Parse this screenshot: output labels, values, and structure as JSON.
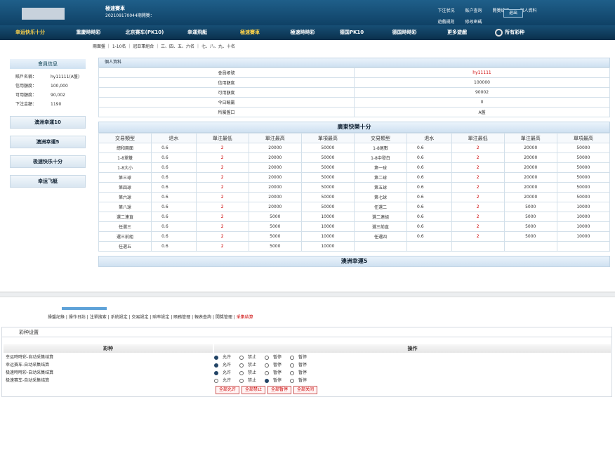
{
  "header": {
    "title": "極速賽車",
    "subtitle": "202109170044期開獎：",
    "links": [
      "下注状况",
      "账户查询",
      "開獎结果",
      "個人資料",
      "遊戲規則",
      "修改密碼"
    ],
    "logout": "退出"
  },
  "nav": [
    {
      "label": "幸运快乐十分",
      "active": true
    },
    {
      "label": "重慶時時彩"
    },
    {
      "label": "北京赛车(PK10)"
    },
    {
      "label": "幸運飛艇"
    },
    {
      "label": "極速賽車",
      "active": true
    },
    {
      "label": "極速時時彩"
    },
    {
      "label": "德国PK10"
    },
    {
      "label": "德国時時彩"
    },
    {
      "label": "更多遊戲"
    },
    {
      "label": "所有彩种"
    }
  ],
  "subnav": "兩面盤 ｜ 1-10名 ｜ 冠亞軍組合 ｜ 三、四、五、六名 ｜ 七、八、九、十名",
  "sidebar": {
    "header": "會員信息",
    "info": [
      {
        "k": "賬戶名稱：",
        "v": "hy11111(A盤)"
      },
      {
        "k": "信用額度：",
        "v": "100,000"
      },
      {
        "k": "可用額度：",
        "v": "90,002"
      },
      {
        "k": "下注金額：",
        "v": "1190"
      }
    ],
    "buttons": [
      "澳洲幸運10",
      "澳洲幸運5",
      "极速快乐十分",
      "幸运飞艇"
    ]
  },
  "personal": {
    "title": "個人資料",
    "rows": [
      {
        "k": "會員帳號",
        "v": "hy11111",
        "red": true
      },
      {
        "k": "信用額度",
        "v": "100000"
      },
      {
        "k": "可用額度",
        "v": "90002"
      },
      {
        "k": "今日輸贏",
        "v": "0"
      },
      {
        "k": "所屬盤口",
        "v": "A盤"
      }
    ]
  },
  "section1": {
    "title": "廣東快樂十分",
    "cols": [
      "交易類型",
      "退水",
      "單注最低",
      "單注最高",
      "單項最高"
    ],
    "left": [
      [
        "總和兩面",
        "0.6",
        "2",
        "20000",
        "50000"
      ],
      [
        "1-8單雙",
        "0.6",
        "2",
        "20000",
        "50000"
      ],
      [
        "1-8大小",
        "0.6",
        "2",
        "20000",
        "50000"
      ],
      [
        "第三球",
        "0.6",
        "2",
        "20000",
        "50000"
      ],
      [
        "第四球",
        "0.6",
        "2",
        "20000",
        "50000"
      ],
      [
        "第六球",
        "0.6",
        "2",
        "20000",
        "50000"
      ],
      [
        "第八球",
        "0.6",
        "2",
        "20000",
        "50000"
      ],
      [
        "選二連直",
        "0.6",
        "2",
        "5000",
        "10000"
      ],
      [
        "任選三",
        "0.6",
        "2",
        "5000",
        "10000"
      ],
      [
        "選三前組",
        "0.6",
        "2",
        "5000",
        "10000"
      ],
      [
        "任選五",
        "0.6",
        "2",
        "5000",
        "10000"
      ]
    ],
    "right": [
      [
        "1-8尾數",
        "0.6",
        "2",
        "20000",
        "50000"
      ],
      [
        "1-8中發白",
        "0.6",
        "2",
        "20000",
        "50000"
      ],
      [
        "第一球",
        "0.6",
        "2",
        "20000",
        "50000"
      ],
      [
        "第二球",
        "0.6",
        "2",
        "20000",
        "50000"
      ],
      [
        "第五球",
        "0.6",
        "2",
        "20000",
        "50000"
      ],
      [
        "第七球",
        "0.6",
        "2",
        "20000",
        "50000"
      ],
      [
        "任選二",
        "0.6",
        "2",
        "5000",
        "10000"
      ],
      [
        "選二連組",
        "0.6",
        "2",
        "5000",
        "10000"
      ],
      [
        "選三前直",
        "0.6",
        "2",
        "5000",
        "10000"
      ],
      [
        "任選四",
        "0.6",
        "2",
        "5000",
        "10000"
      ]
    ]
  },
  "section2": {
    "title": "澳洲幸運5"
  },
  "admin": {
    "links": [
      "操盤記錄",
      "操作日誌",
      "注單搜索",
      "系統設定",
      "交易設定",
      "賠率設定",
      "賬務管理",
      "報表查詢",
      "開獎管理",
      "采集結算"
    ],
    "panel_title": "彩种设置",
    "col_game": "彩种",
    "col_op": "操作",
    "options": [
      "允许",
      "禁止",
      "暂停",
      "暂停"
    ],
    "rows": [
      {
        "label": "幸运時時彩-自动采集结算",
        "sel": 0
      },
      {
        "label": "幸运赛车-自动采集结算",
        "sel": 0
      },
      {
        "label": "极速時時彩-自动采集结算",
        "sel": 0
      },
      {
        "label": "极速赛车-自动采集结算",
        "sel": 2
      }
    ],
    "buttons": [
      "全部允许",
      "全部禁止",
      "全部暂停",
      "全部关闭"
    ]
  }
}
